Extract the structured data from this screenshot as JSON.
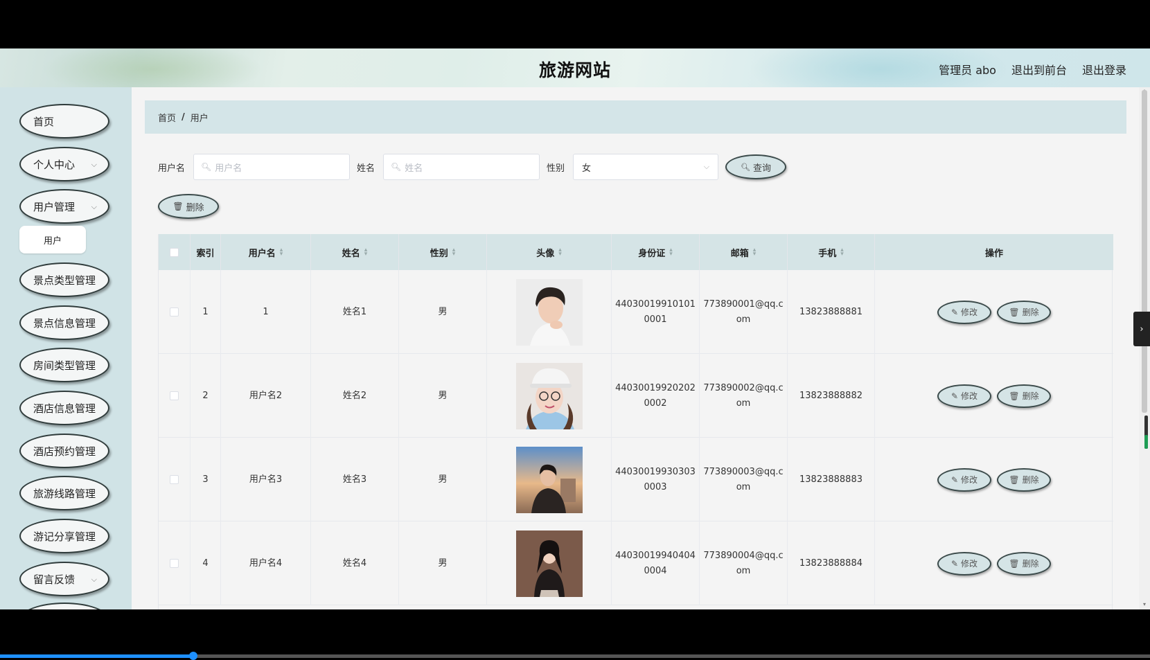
{
  "header": {
    "title": "旅游网站",
    "admin": "管理员 abo",
    "back_front": "退出到前台",
    "logout": "退出登录"
  },
  "sidebar": {
    "items": [
      {
        "label": "首页",
        "has_arrow": false
      },
      {
        "label": "个人中心",
        "has_arrow": true
      },
      {
        "label": "用户管理",
        "has_arrow": true
      },
      {
        "label": "景点类型管理",
        "has_arrow": false
      },
      {
        "label": "景点信息管理",
        "has_arrow": false
      },
      {
        "label": "房间类型管理",
        "has_arrow": false
      },
      {
        "label": "酒店信息管理",
        "has_arrow": false
      },
      {
        "label": "酒店预约管理",
        "has_arrow": false
      },
      {
        "label": "旅游线路管理",
        "has_arrow": false
      },
      {
        "label": "游记分享管理",
        "has_arrow": false
      },
      {
        "label": "留言反馈",
        "has_arrow": true
      }
    ],
    "sub_item": "用户"
  },
  "breadcrumb": {
    "home": "首页",
    "sep": "/",
    "current": "用户"
  },
  "search": {
    "username_label": "用户名",
    "username_placeholder": "用户名",
    "name_label": "姓名",
    "name_placeholder": "姓名",
    "gender_label": "性别",
    "gender_value": "女",
    "query_button": "查询"
  },
  "toolbar": {
    "delete_button": "删除"
  },
  "table": {
    "columns": [
      "",
      "索引",
      "用户名",
      "姓名",
      "性别",
      "头像",
      "身份证",
      "邮箱",
      "手机",
      "操作"
    ],
    "rows": [
      {
        "index": "1",
        "username": "1",
        "name": "姓名1",
        "gender": "男",
        "id_card_1": "44030019910101",
        "id_card_2": "0001",
        "email_1": "773890001@qq.c",
        "email_2": "om",
        "phone": "13823888881"
      },
      {
        "index": "2",
        "username": "用户名2",
        "name": "姓名2",
        "gender": "男",
        "id_card_1": "44030019920202",
        "id_card_2": "0002",
        "email_1": "773890002@qq.c",
        "email_2": "om",
        "phone": "13823888882"
      },
      {
        "index": "3",
        "username": "用户名3",
        "name": "姓名3",
        "gender": "男",
        "id_card_1": "44030019930303",
        "id_card_2": "0003",
        "email_1": "773890003@qq.c",
        "email_2": "om",
        "phone": "13823888883"
      },
      {
        "index": "4",
        "username": "用户名4",
        "name": "姓名4",
        "gender": "男",
        "id_card_1": "44030019940404",
        "id_card_2": "0004",
        "email_1": "773890004@qq.c",
        "email_2": "om",
        "phone": "13823888884"
      }
    ],
    "edit_button": "修改",
    "delete_button": "删除"
  },
  "colors": {
    "sidebar_bg": "#d0e3e6",
    "header_row_bg": "#d5e4e6",
    "main_bg": "#f4f4f4"
  },
  "video": {
    "progress": 0.168
  }
}
